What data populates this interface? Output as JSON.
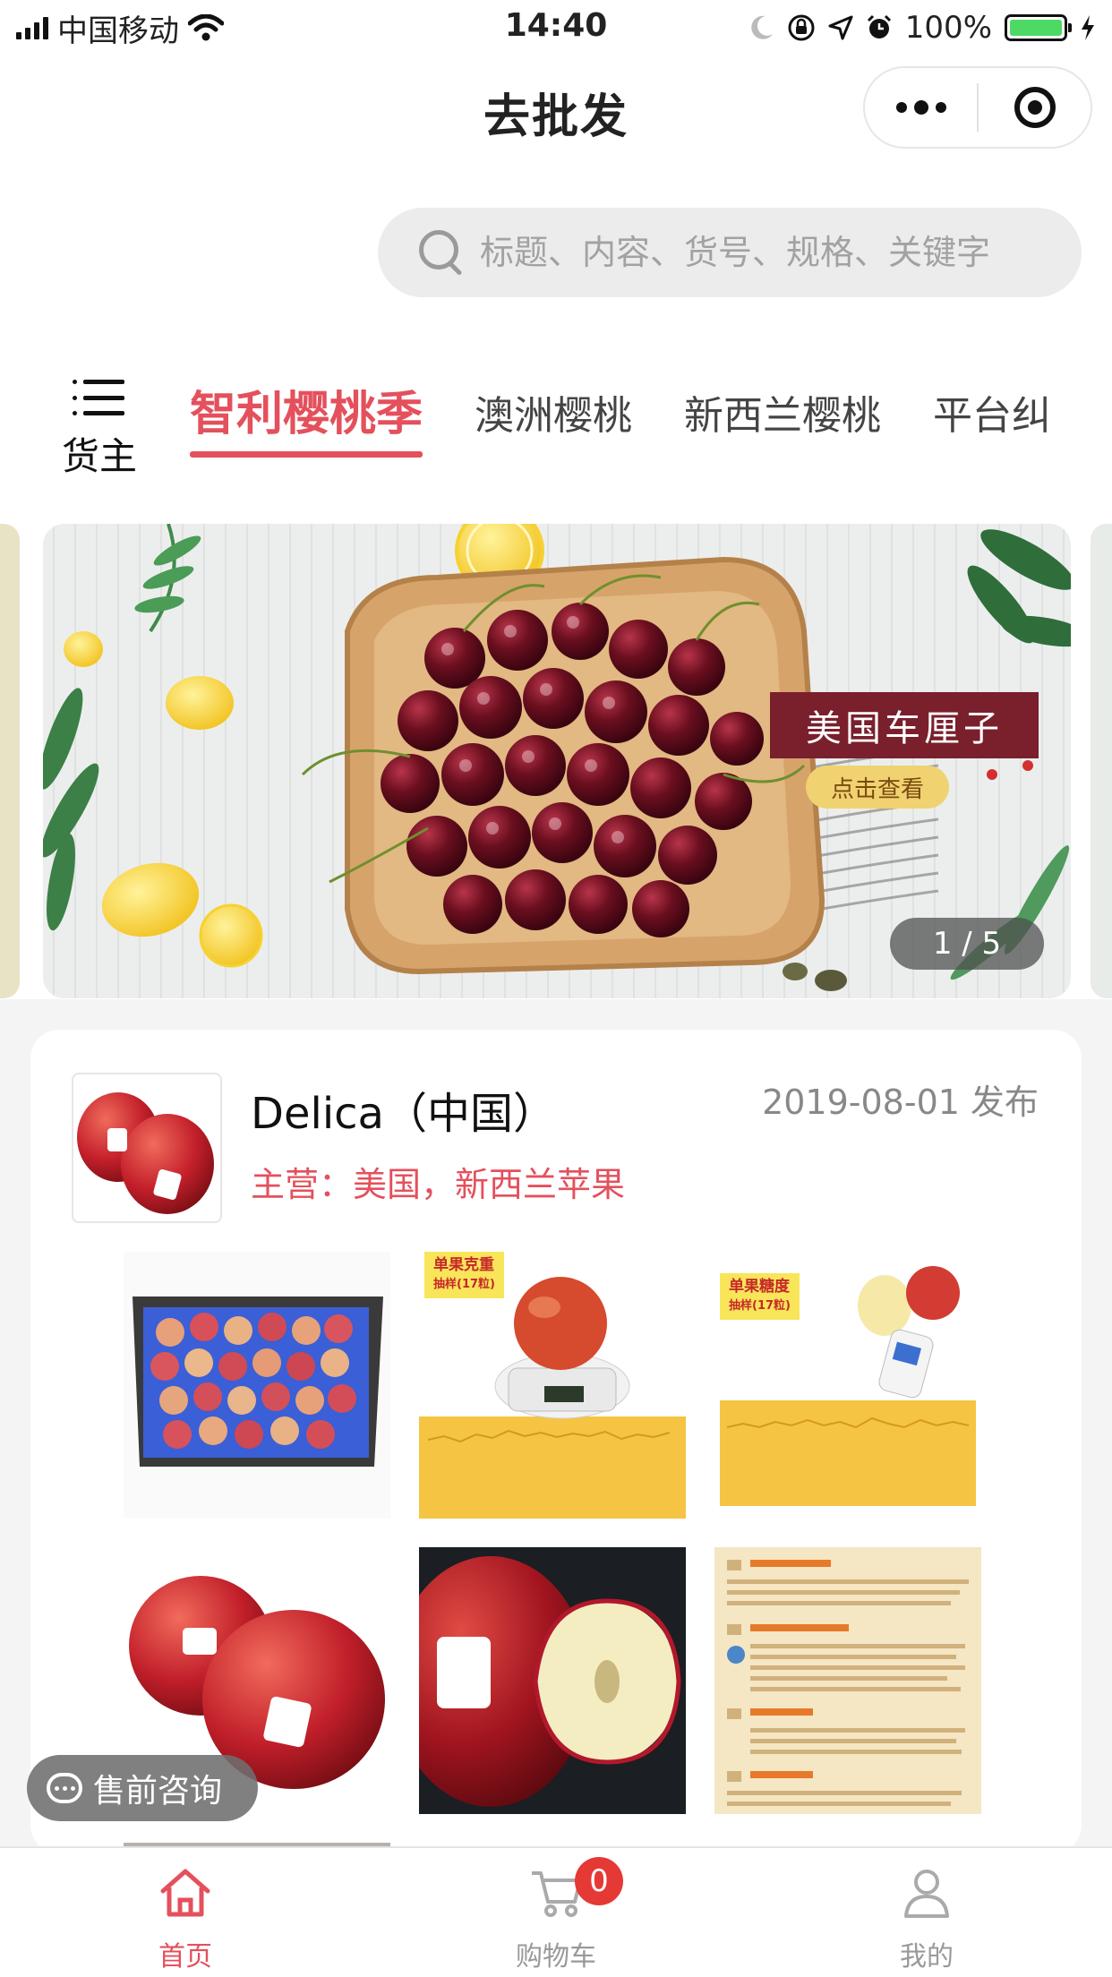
{
  "status_bar": {
    "carrier": "中国移动",
    "time": "14:40",
    "battery": "100%",
    "battery_level": 1.0
  },
  "nav": {
    "title": "去批发"
  },
  "search": {
    "placeholder": "标题、内容、货号、规格、关键字"
  },
  "category": {
    "shipper_label": "货主",
    "tabs": [
      "智利樱桃季",
      "澳洲樱桃",
      "新西兰樱桃",
      "平台纠"
    ],
    "active_index": 0
  },
  "banner": {
    "tag": "美国车厘子",
    "cta": "点击查看",
    "indicator": "1 / 5"
  },
  "store": {
    "name": "Delica（中国）",
    "publish_date": "2019-08-01 发布",
    "main_business": "主营：美国，新西兰苹果"
  },
  "gallery": {
    "weight_label": "单果克重",
    "weight_sub": "抽样(17粒)",
    "sugar_label": "单果糖度",
    "sugar_sub": "抽样(17粒)"
  },
  "consult": {
    "label": "售前咨询"
  },
  "tabbar": {
    "home": "首页",
    "cart": "购物车",
    "cart_count": "0",
    "mine": "我的"
  },
  "colors": {
    "accent": "#e4505c",
    "badge": "#e53935",
    "battery": "#4cd964"
  }
}
